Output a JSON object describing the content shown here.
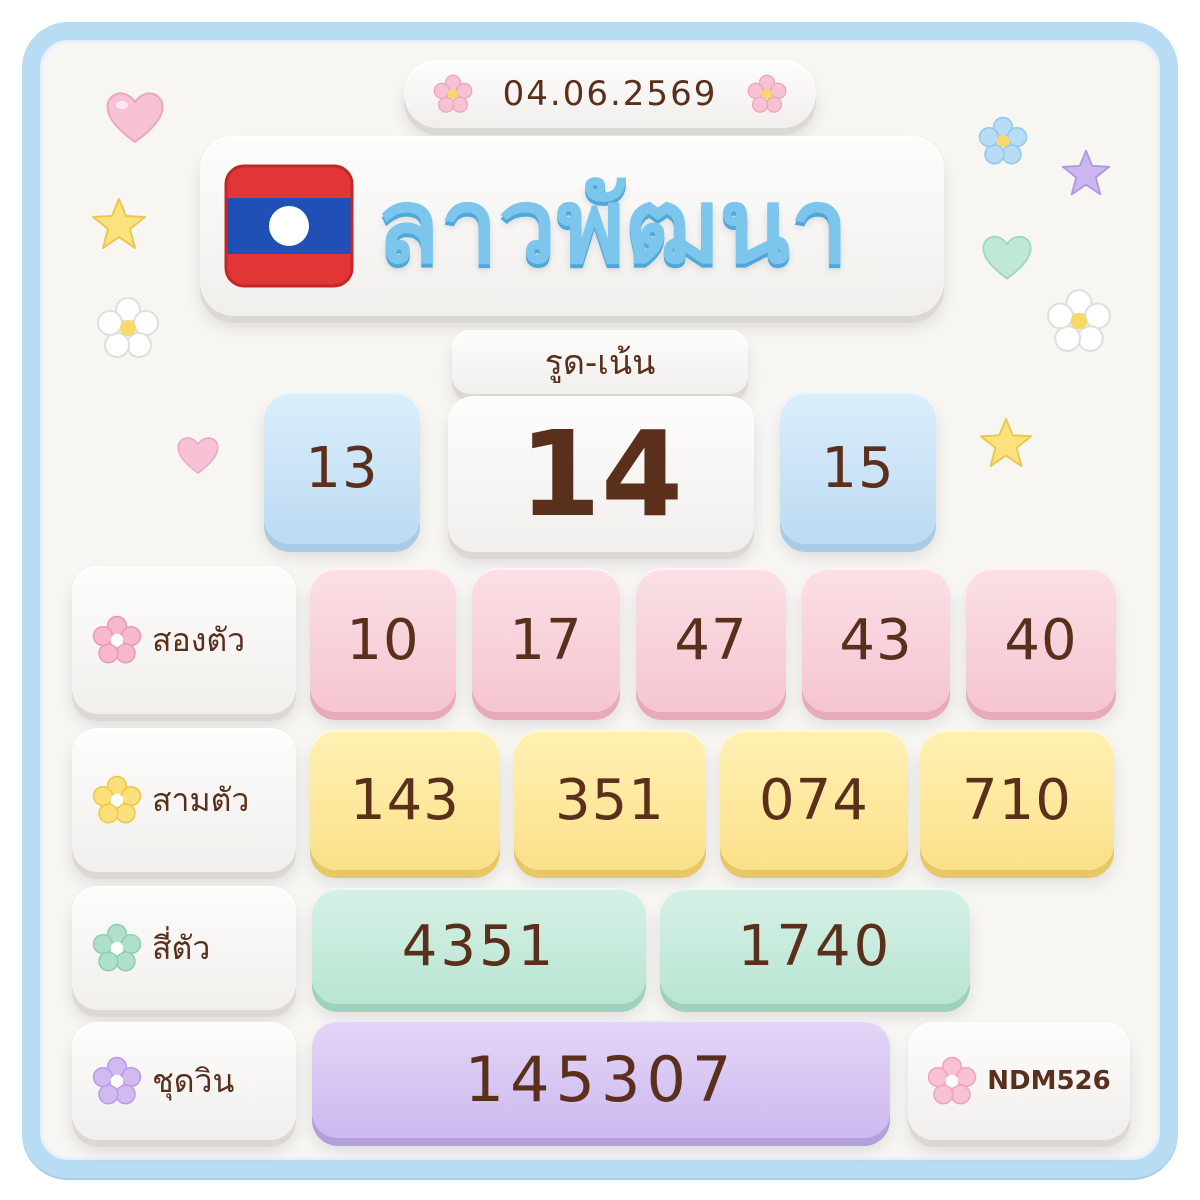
{
  "date": "04.06.2569",
  "title": "ลาวพัฒนา",
  "colors": {
    "frame": "#b9dcf5",
    "title_text": "#7cc6ee",
    "number_text": "#5a2f1c",
    "flag_red": "#e23636",
    "flag_blue": "#2050b6"
  },
  "highlight": {
    "label": "รูด-เน้น",
    "left": "13",
    "main": "14",
    "right": "15"
  },
  "two_digit": {
    "label": "สองตัว",
    "values": [
      "10",
      "17",
      "47",
      "43",
      "40"
    ]
  },
  "three_digit": {
    "label": "สามตัว",
    "values": [
      "143",
      "351",
      "074",
      "710"
    ]
  },
  "four_digit": {
    "label": "สี่ตัว",
    "values": [
      "4351",
      "1740"
    ]
  },
  "win_set": {
    "label": "ชุดวิน",
    "value": "145307"
  },
  "code": "NDM526",
  "icons": {
    "flag": "laos-flag-icon",
    "flower": "flower-icon",
    "heart": "heart-icon",
    "star": "star-icon"
  }
}
